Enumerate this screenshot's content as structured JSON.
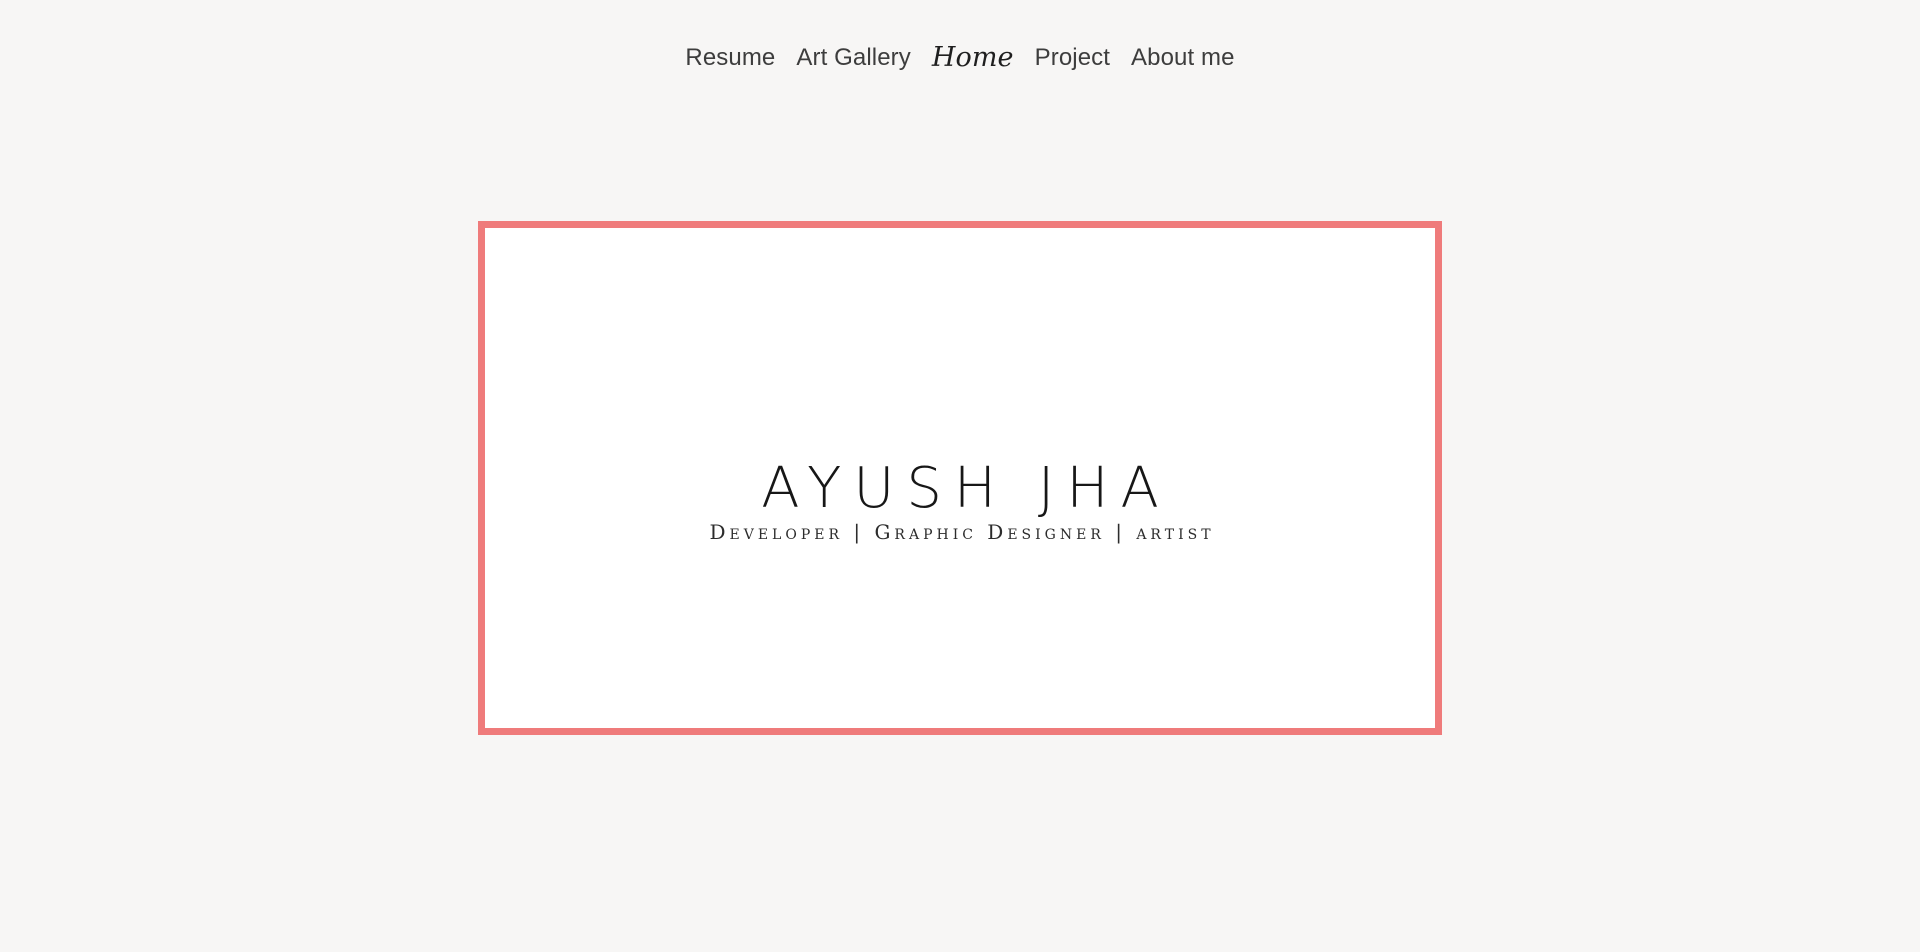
{
  "nav": {
    "items": [
      {
        "label": "Resume"
      },
      {
        "label": "Art Gallery"
      },
      {
        "label": "Home",
        "active": true
      },
      {
        "label": "Project"
      },
      {
        "label": "About me"
      }
    ]
  },
  "hero": {
    "name": "AYUSH JHA",
    "tagline": "Developer | Graphic Designer | artist"
  },
  "colors": {
    "background": "#f7f6f5",
    "card_border": "#ef7b7b",
    "card_background": "#ffffff",
    "text_dark": "#171717",
    "nav_text": "#3d3d3d"
  }
}
